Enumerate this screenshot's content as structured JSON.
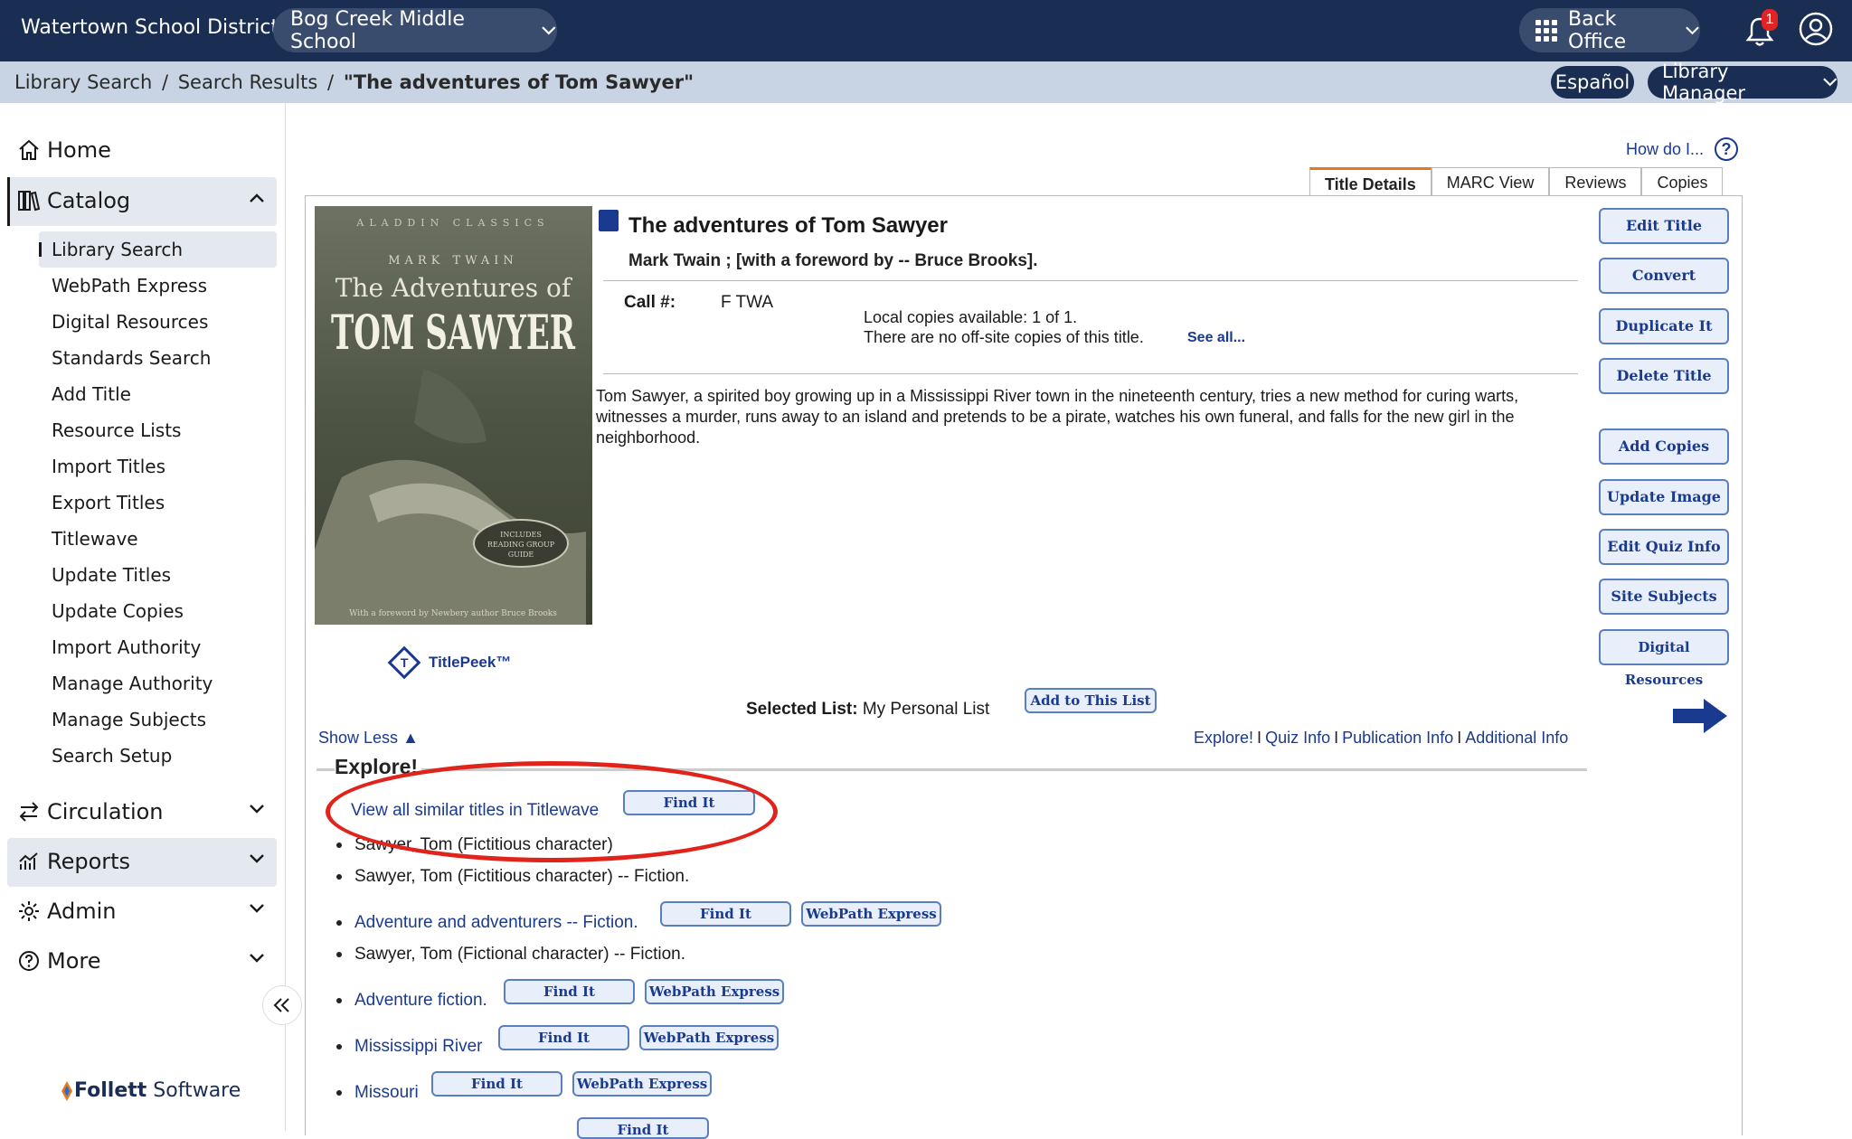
{
  "header": {
    "district": "Watertown School District",
    "school": "Bog Creek Middle School",
    "back_office": "Back Office",
    "notification_count": "1"
  },
  "subbar": {
    "crumb_1": "Library Search",
    "crumb_2": "Search Results",
    "crumb_current": "\"The adventures of Tom Sawyer\"",
    "separator": "/",
    "language": "Español",
    "role": "Library Manager"
  },
  "sidebar": {
    "home": "Home",
    "catalog": "Catalog",
    "catalog_items": [
      "Library Search",
      "WebPath Express",
      "Digital Resources",
      "Standards Search",
      "Add Title",
      "Resource Lists",
      "Import Titles",
      "Export Titles",
      "Titlewave",
      "Update Titles",
      "Update Copies",
      "Import Authority",
      "Manage Authority",
      "Manage Subjects",
      "Search Setup"
    ],
    "circulation": "Circulation",
    "reports": "Reports",
    "admin": "Admin",
    "more": "More",
    "brand_1": "Follett",
    "brand_2": " Software"
  },
  "content": {
    "how_do_i": "How do I...",
    "help_glyph": "?",
    "tabs": [
      "Title Details",
      "MARC View",
      "Reviews",
      "Copies"
    ],
    "cover": {
      "series": "ALADDIN CLASSICS",
      "author": "MARK TWAIN",
      "title_top": "The Adventures of",
      "title_main": "TOM SAWYER",
      "badge_1": "INCLUDES",
      "badge_2": "READING GROUP",
      "badge_3": "GUIDE",
      "foreword": "With a foreword by Newbery author Bruce Brooks"
    },
    "titlepeek": "TitlePeek™",
    "titlepeek_glyph": "T",
    "title": "The adventures of Tom Sawyer",
    "author_line": "Mark Twain ; [with a foreword by -- Bruce Brooks].",
    "call_label": "Call #:",
    "call_value": "F TWA",
    "local_copies": "Local copies available: 1 of 1.",
    "offsite": "There are no off-site copies of this title.",
    "see_all": "See all...",
    "summary": "Tom Sawyer, a spirited boy growing up in a Mississippi River town in the nineteenth century, tries a new method for curing warts, witnesses a murder, runs away to an island and pretends to be a pirate, watches his own funeral, and falls for the new girl in the neighborhood.",
    "right_buttons": [
      "Edit Title",
      "Convert",
      "Duplicate It",
      "Delete Title",
      "Add Copies",
      "Update Image",
      "Edit Quiz Info",
      "Site Subjects",
      "Digital Resources"
    ],
    "selected_list_label": "Selected List:",
    "selected_list_value": " My Personal List",
    "add_to_list": "Add to This List",
    "show_less": "Show Less",
    "show_less_arrow": "▲",
    "links": [
      "Explore!",
      "Quiz Info",
      "Publication Info",
      "Additional Info"
    ],
    "link_separator": "I",
    "explore_heading": "Explore!",
    "explore": {
      "similar": "View all similar titles in Titlewave",
      "find_it": "Find It",
      "webpath": "WebPath Express",
      "items": [
        "Sawyer, Tom (Fictitious character)",
        "Sawyer, Tom (Fictitious character) -- Fiction.",
        "Adventure and adventurers -- Fiction.",
        "Sawyer, Tom (Fictional character) -- Fiction.",
        "Adventure fiction.",
        "Mississippi River",
        "Missouri"
      ]
    }
  }
}
